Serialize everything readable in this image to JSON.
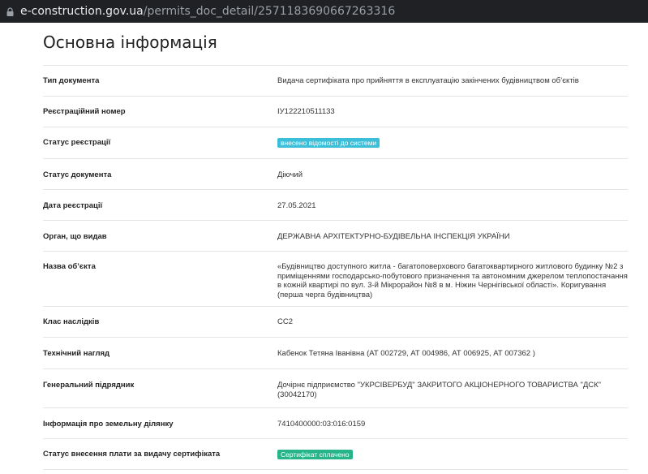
{
  "browser": {
    "url_host": "e-construction.gov.ua",
    "url_path": "/permits_doc_detail/2571183690667263316"
  },
  "section_title": "Основна інформація",
  "rows": [
    {
      "label": "Тип документа",
      "value": "Видача сертифіката про прийняття в експлуатацію закінчених будівництвом об’єктів"
    },
    {
      "label": "Реєстраційний номер",
      "value": "ІУ122210511133"
    },
    {
      "label": "Статус реєстрації",
      "value": "внесено відомості до системи",
      "badge_color": "#3bbfd9"
    },
    {
      "label": "Статус документа",
      "value": "Діючий"
    },
    {
      "label": "Дата реєстрації",
      "value": "27.05.2021"
    },
    {
      "label": "Орган, що видав",
      "value": "ДЕРЖАВНА АРХІТЕКТУРНО-БУДІВЕЛЬНА ІНСПЕКЦІЯ УКРАЇНИ"
    },
    {
      "label": "Назва об’єкта",
      "value": "«Будівництво доступного житла - багатоповерхового багатоквартирного житлового будинку №2 з приміщеннями господарсько-побутового призначення та автономним джерелом теплопостачання в кожній квартирі по вул. 3-й Мікрорайон №8 в м. Ніжин Чернігівської області». Коригування (перша черга будівництва)"
    },
    {
      "label": "Клас наслідків",
      "value": "СС2"
    },
    {
      "label": "Технічний нагляд",
      "value": "Кабенок Тетяна Іванівна (АТ 002729, АТ 004986, АТ 006925, АТ 007362 )"
    },
    {
      "label": "Генеральний підрядник",
      "value": "Дочірнє підприємство \"УКРСІВЕРБУД\" ЗАКРИТОГО АКЦІОНЕРНОГО ТОВАРИСТВА \"ДСК\" (30042170)"
    },
    {
      "label": "Інформація про земельну ділянку",
      "value": "7410400000:03:016:0159"
    },
    {
      "label": "Статус внесення плати за видачу сертифіката",
      "value": "Сертифікат сплачено",
      "badge_color": "#27b489"
    }
  ]
}
